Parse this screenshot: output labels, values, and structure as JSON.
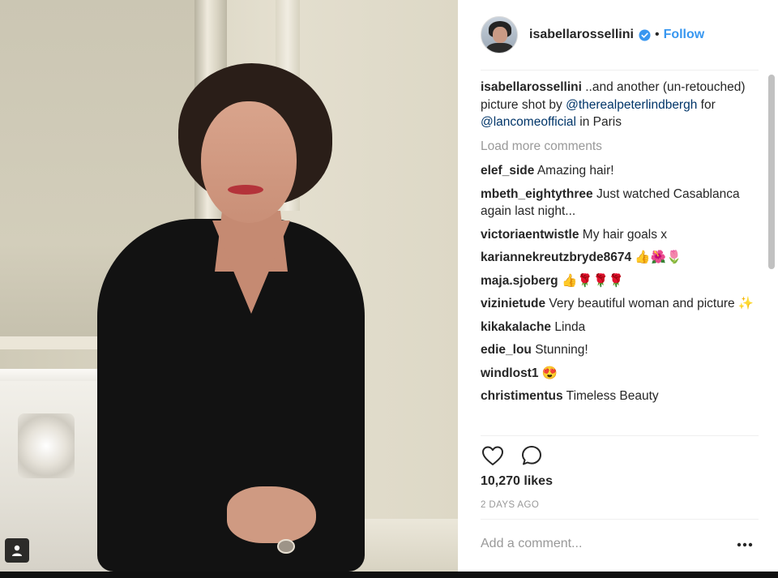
{
  "post": {
    "username": "isabellarossellini",
    "follow_label": "Follow",
    "separator": "•",
    "caption": {
      "user": "isabellarossellini",
      "text_1": " ..and another (un-retouched) picture shot by ",
      "mention_1": "@therealpeterlindbergh",
      "text_2": " for ",
      "mention_2": "@lancomeofficial",
      "text_3": " in Paris"
    },
    "load_more": "Load more comments",
    "comments": [
      {
        "user": "elef_side",
        "text": "Amazing hair!"
      },
      {
        "user": "mbeth_eightythree",
        "text": "Just watched Casablanca again last night..."
      },
      {
        "user": "victoriaentwistle",
        "text": "My hair goals x"
      },
      {
        "user": "kariannekreutzbryde8674",
        "text": "👍🌺🌷"
      },
      {
        "user": "maja.sjoberg",
        "text": "👍🌹🌹🌹"
      },
      {
        "user": "vizinietude",
        "text": "Very beautiful woman and picture ✨"
      },
      {
        "user": "kikakalache",
        "text": "Linda"
      },
      {
        "user": "edie_lou",
        "text": "Stunning!"
      },
      {
        "user": "windlost1",
        "text": "😍"
      },
      {
        "user": "christimentus",
        "text": "Timeless Beauty"
      }
    ],
    "likes": "10,270 likes",
    "timestamp": "2 DAYS AGO",
    "comment_placeholder": "Add a comment...",
    "more_label": "•••"
  },
  "icons": {
    "verified": "verified-badge-icon",
    "like": "heart-icon",
    "comment": "speech-bubble-icon",
    "user_tag": "person-tag-icon",
    "more": "more-options-icon"
  },
  "colors": {
    "link": "#3897f0",
    "mention": "#003569",
    "muted": "#999999",
    "text": "#262626"
  }
}
